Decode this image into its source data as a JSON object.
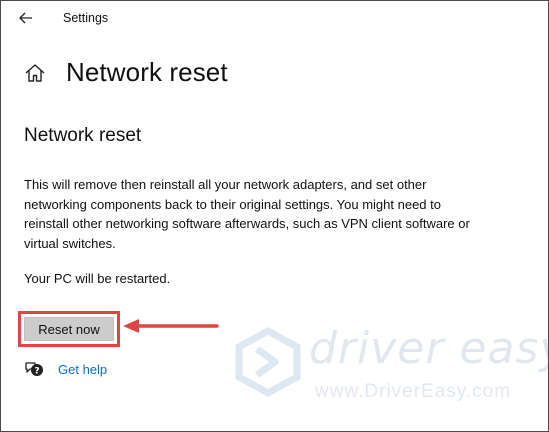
{
  "window": {
    "title": "Settings"
  },
  "header": {
    "page_title": "Network reset"
  },
  "section": {
    "title": "Network reset",
    "description": "This will remove then reinstall all your network adapters, and set other networking components back to their original settings. You might need to reinstall other networking software afterwards, such as VPN client software or virtual switches.",
    "restart_note": "Your PC will be restarted.",
    "reset_button_label": "Reset now"
  },
  "help": {
    "link_label": "Get help"
  },
  "watermark": {
    "brand": "driver easy",
    "url": "www.DriverEasy.com"
  },
  "icons": {
    "back": "back-arrow-icon",
    "home": "home-icon",
    "help": "help-chat-icon",
    "annotation_arrow": "red-arrow-icon",
    "watermark_logo": "drivereasy-logo-icon"
  },
  "colors": {
    "link": "#0b6ec5",
    "highlight": "#e04545",
    "button_bg": "#cccccc",
    "watermark": "#7b97b5"
  }
}
